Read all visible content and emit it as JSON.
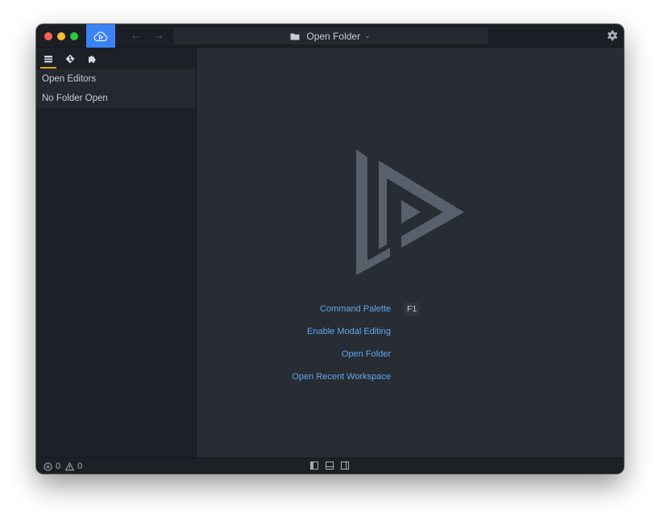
{
  "titlebar": {
    "palette_label": "Open Folder",
    "back_icon": "arrow-left-icon",
    "forward_icon": "arrow-right-icon",
    "accent_color": "#3b82f6"
  },
  "sidebar": {
    "tabs": [
      {
        "name": "explorer",
        "icon": "files-icon",
        "active": true
      },
      {
        "name": "source-control",
        "icon": "git-icon",
        "active": false
      },
      {
        "name": "plugins",
        "icon": "puzzle-icon",
        "active": false
      }
    ],
    "active_tab_color": "#e5a31a",
    "items": [
      {
        "label": "Open Editors"
      },
      {
        "label": "No Folder Open"
      }
    ]
  },
  "main": {
    "commands": [
      {
        "label": "Command Palette",
        "key": "F1"
      },
      {
        "label": "Enable Modal Editing"
      },
      {
        "label": "Open Folder"
      },
      {
        "label": "Open Recent Workspace"
      }
    ],
    "link_color": "#5fa9ee"
  },
  "statusbar": {
    "error_count": "0",
    "warning_count": "0"
  }
}
